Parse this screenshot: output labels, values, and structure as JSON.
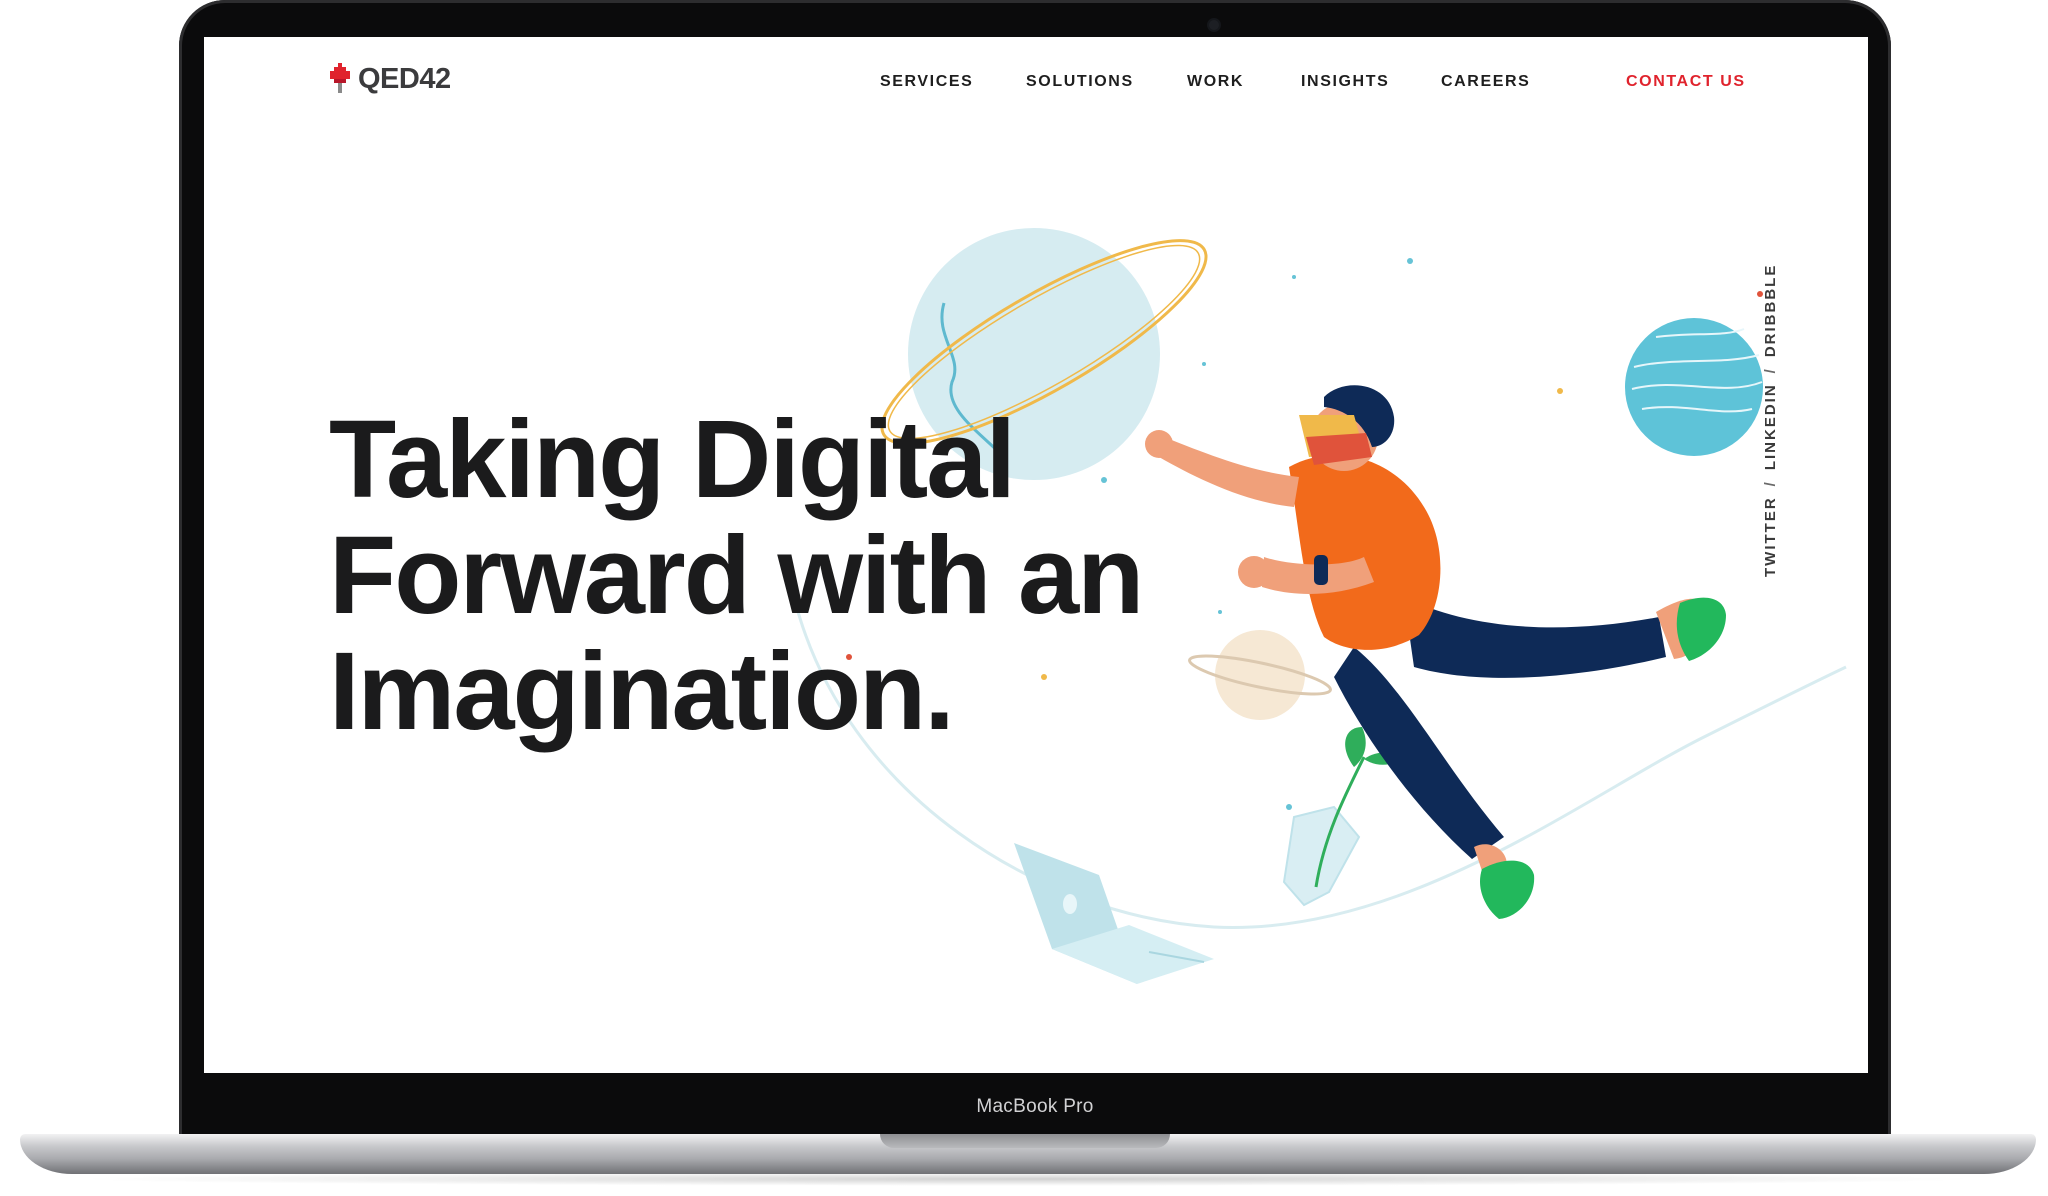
{
  "device": {
    "bezel_label": "MacBook Pro"
  },
  "site": {
    "logo_text": "QED42",
    "nav": [
      {
        "label": "SERVICES"
      },
      {
        "label": "SOLUTIONS"
      },
      {
        "label": "WORK"
      },
      {
        "label": "INSIGHTS"
      },
      {
        "label": "CAREERS"
      }
    ],
    "contact_label": "CONTACT US",
    "hero": {
      "line1": "Taking Digital",
      "line2": "Forward with an",
      "line3": "Imagination."
    },
    "social": {
      "twitter": "TWITTER",
      "linkedin": "LINKEDIN",
      "dribbble": "DRIBBBLE",
      "separator": "/"
    }
  },
  "colors": {
    "accent": "#e0232d",
    "text_dark": "#1b1b1c",
    "planet_blue": "#d8edf1",
    "planet_teal": "#5ec3d8",
    "shirt_orange": "#f26a1b",
    "pants_navy": "#0e2a57",
    "shoe_green": "#22b85c"
  }
}
